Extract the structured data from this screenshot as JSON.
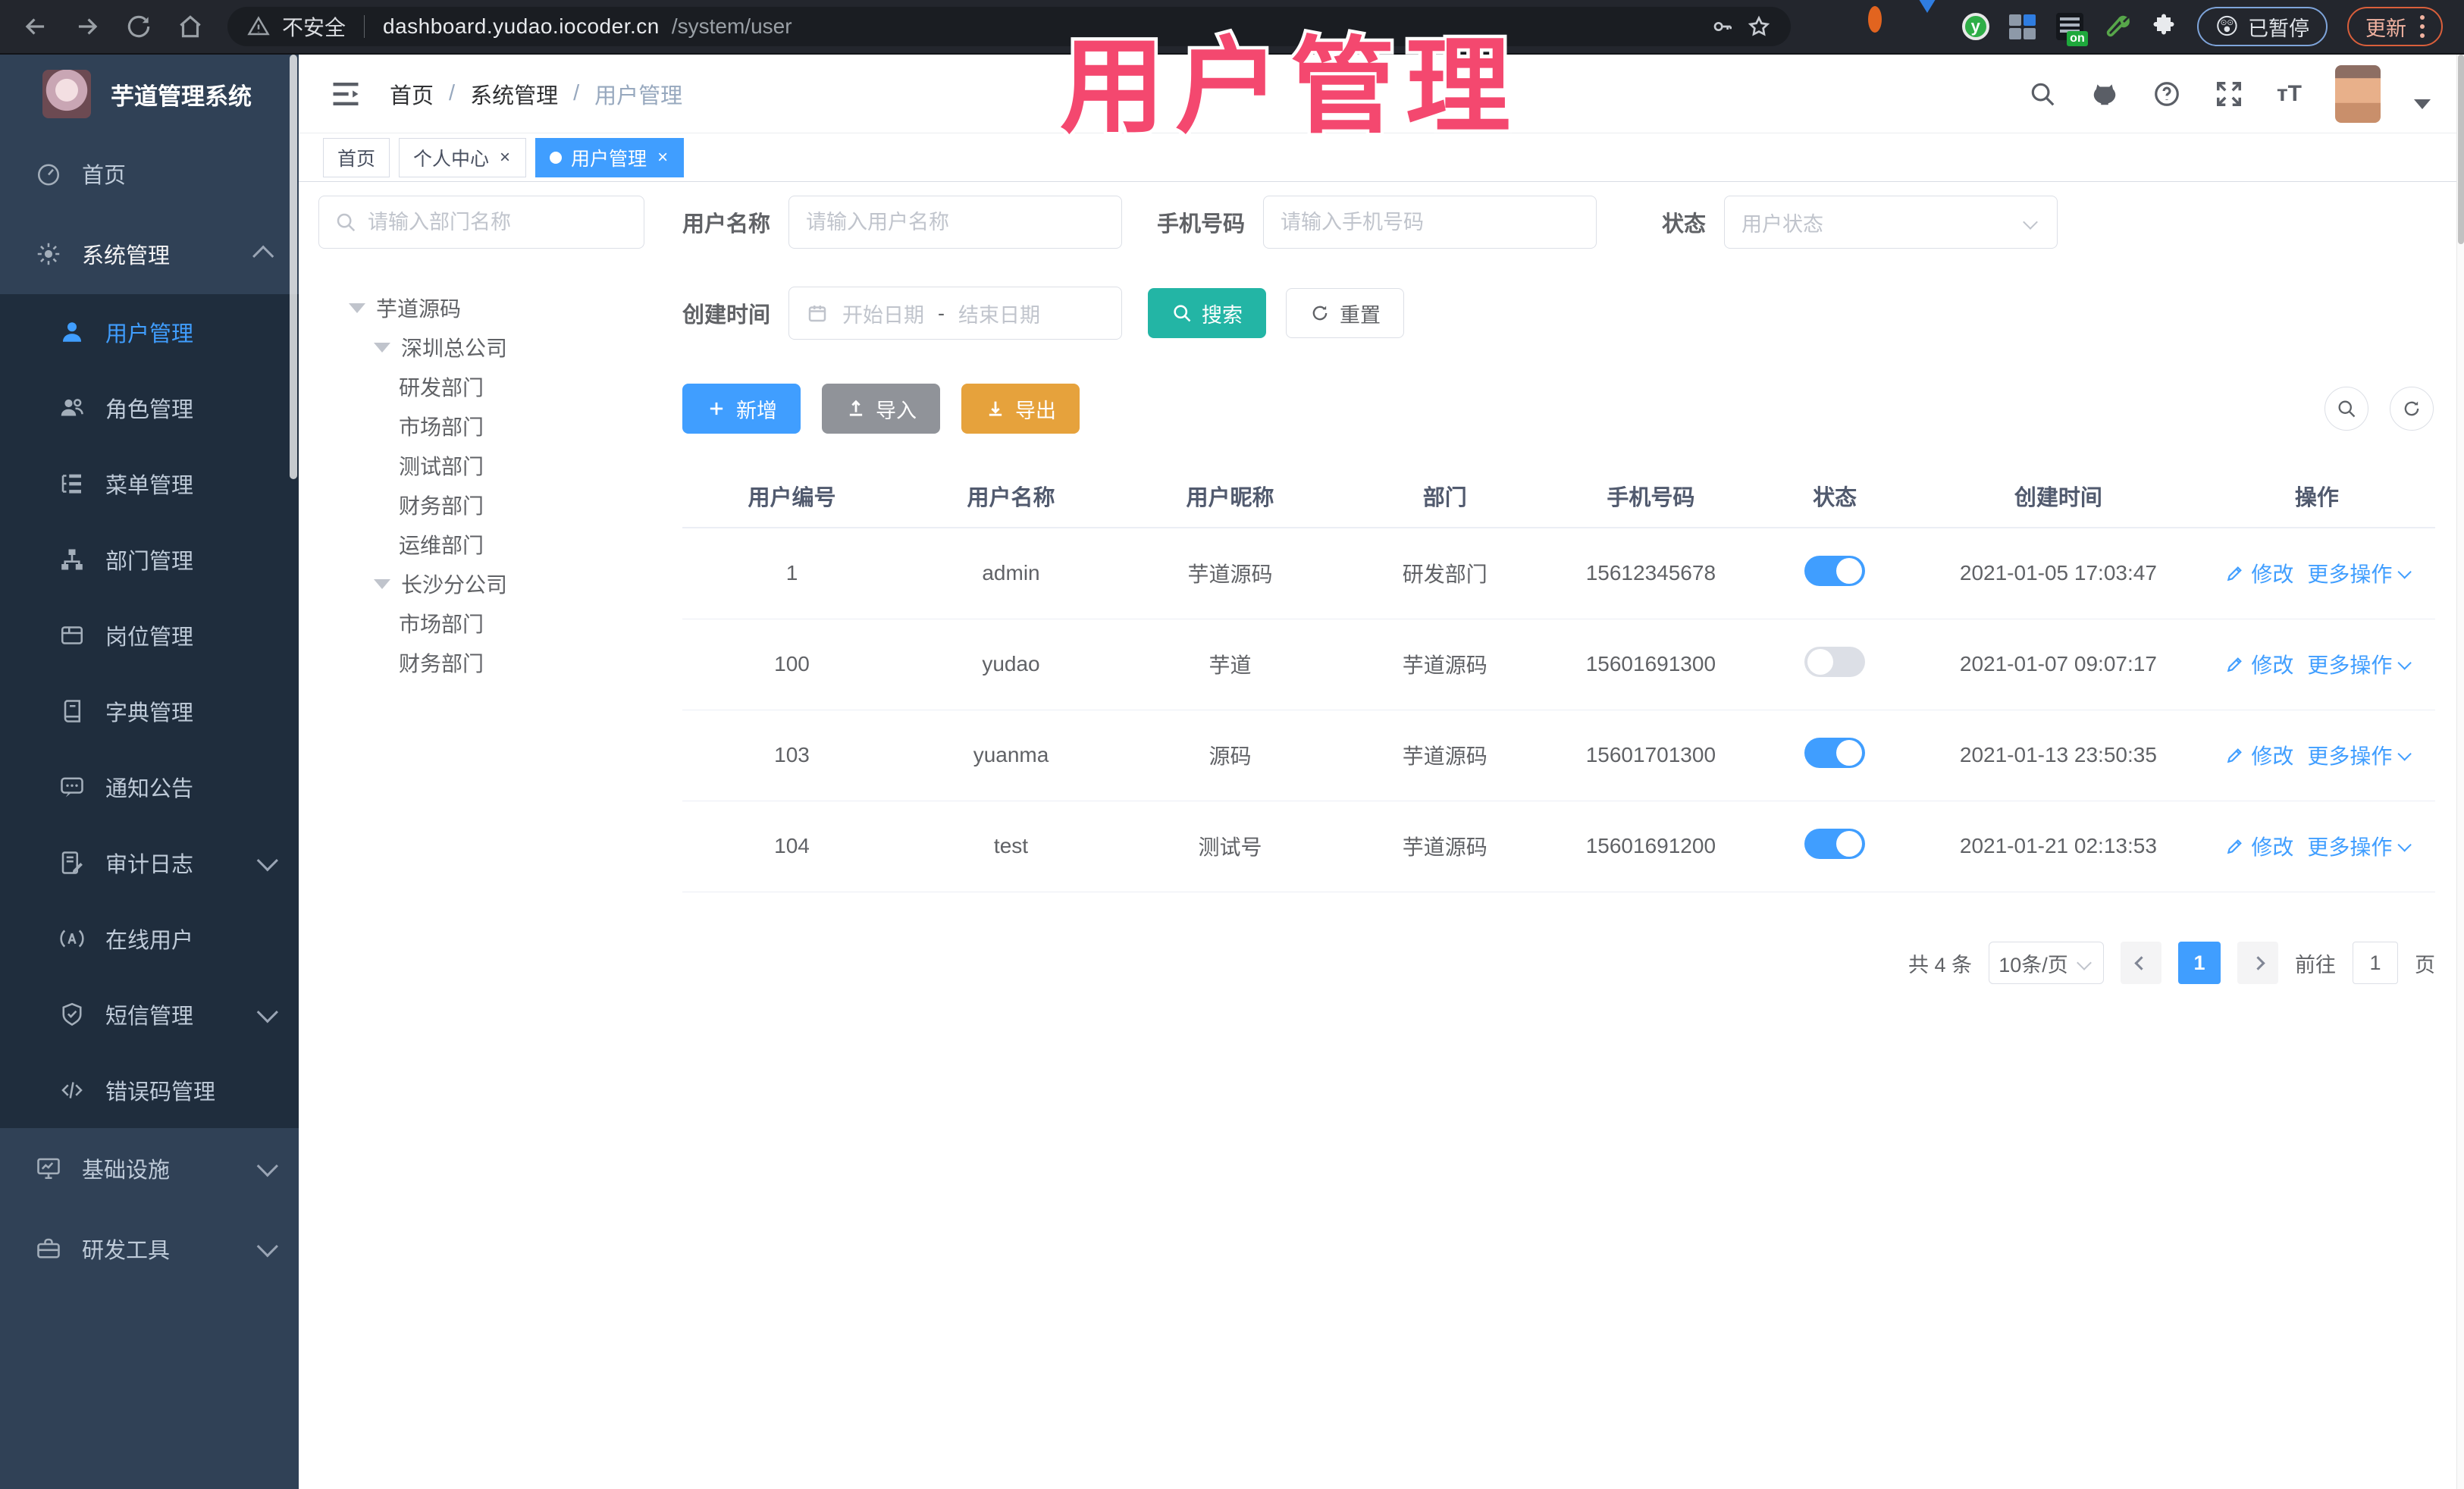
{
  "browser": {
    "security_label": "不安全",
    "url_host": "dashboard.yudao.iocoder.cn",
    "url_path": "/system/user",
    "paused_label": "已暂停",
    "paused_emoji": "😲",
    "update_label": "更新"
  },
  "overlay": {
    "title": "用户管理"
  },
  "colors": {
    "accent": "#409EFF",
    "search_button": "#23b5a5",
    "export_button": "#E6A23C",
    "sidebar_bg": "#304156",
    "submenu_bg": "#1f2d3d",
    "overlay_pink": "#f4486f"
  },
  "sidebar": {
    "app_title": "芋道管理系统",
    "items_before": [
      {
        "label": "首页",
        "icon": "dashboard-icon"
      },
      {
        "label": "系统管理",
        "icon": "gear-icon",
        "arrow": "up",
        "bright": true
      }
    ],
    "submenu": [
      {
        "label": "用户管理",
        "icon": "user-icon",
        "active": true
      },
      {
        "label": "角色管理",
        "icon": "users-icon"
      },
      {
        "label": "菜单管理",
        "icon": "tree-table-icon"
      },
      {
        "label": "部门管理",
        "icon": "org-tree-icon"
      },
      {
        "label": "岗位管理",
        "icon": "post-icon"
      },
      {
        "label": "字典管理",
        "icon": "dict-icon"
      },
      {
        "label": "通知公告",
        "icon": "message-icon"
      },
      {
        "label": "审计日志",
        "icon": "log-icon",
        "arrow": "down"
      },
      {
        "label": "在线用户",
        "icon": "online-icon"
      },
      {
        "label": "短信管理",
        "icon": "shield-check-icon",
        "arrow": "down"
      },
      {
        "label": "错误码管理",
        "icon": "code-icon"
      }
    ],
    "items_after": [
      {
        "label": "基础设施",
        "icon": "monitor-icon",
        "arrow": "down"
      },
      {
        "label": "研发工具",
        "icon": "toolbox-icon",
        "arrow": "down"
      }
    ]
  },
  "header": {
    "breadcrumb": [
      "首页",
      "系统管理",
      "用户管理"
    ]
  },
  "tabs": [
    {
      "label": "首页",
      "closable": false,
      "active": false
    },
    {
      "label": "个人中心",
      "closable": true,
      "active": false
    },
    {
      "label": "用户管理",
      "closable": true,
      "active": true
    }
  ],
  "tree": {
    "search_placeholder": "请输入部门名称",
    "nodes": [
      {
        "label": "芋道源码",
        "level": 0,
        "caret": true
      },
      {
        "label": "深圳总公司",
        "level": 1,
        "caret": true
      },
      {
        "label": "研发部门",
        "level": 2,
        "caret": false
      },
      {
        "label": "市场部门",
        "level": 2,
        "caret": false
      },
      {
        "label": "测试部门",
        "level": 2,
        "caret": false
      },
      {
        "label": "财务部门",
        "level": 2,
        "caret": false
      },
      {
        "label": "运维部门",
        "level": 2,
        "caret": false
      },
      {
        "label": "长沙分公司",
        "level": 1,
        "caret": true
      },
      {
        "label": "市场部门",
        "level": 2,
        "caret": false
      },
      {
        "label": "财务部门",
        "level": 2,
        "caret": false
      }
    ]
  },
  "filters": {
    "username_label": "用户名称",
    "username_placeholder": "请输入用户名称",
    "mobile_label": "手机号码",
    "mobile_placeholder": "请输入手机号码",
    "status_label": "状态",
    "status_placeholder": "用户状态",
    "date_label": "创建时间",
    "date_start": "开始日期",
    "date_sep": "-",
    "date_end": "结束日期",
    "search_label": "搜索",
    "reset_label": "重置"
  },
  "toolbar": {
    "add_label": "新增",
    "import_label": "导入",
    "export_label": "导出"
  },
  "table": {
    "columns": [
      "用户编号",
      "用户名称",
      "用户昵称",
      "部门",
      "手机号码",
      "状态",
      "创建时间",
      "操作"
    ],
    "actions": {
      "edit": "修改",
      "more": "更多操作"
    },
    "rows": [
      {
        "id": "1",
        "username": "admin",
        "nickname": "芋道源码",
        "dept": "研发部门",
        "mobile": "15612345678",
        "status": true,
        "created": "2021-01-05 17:03:47"
      },
      {
        "id": "100",
        "username": "yudao",
        "nickname": "芋道",
        "dept": "芋道源码",
        "mobile": "15601691300",
        "status": false,
        "created": "2021-01-07 09:07:17"
      },
      {
        "id": "103",
        "username": "yuanma",
        "nickname": "源码",
        "dept": "芋道源码",
        "mobile": "15601701300",
        "status": true,
        "created": "2021-01-13 23:50:35"
      },
      {
        "id": "104",
        "username": "test",
        "nickname": "测试号",
        "dept": "芋道源码",
        "mobile": "15601691200",
        "status": true,
        "created": "2021-01-21 02:13:53"
      }
    ]
  },
  "pagination": {
    "total_text": "共 4 条",
    "page_size": "10条/页",
    "current_page": "1",
    "goto_label": "前往",
    "goto_value": "1",
    "page_unit": "页"
  }
}
